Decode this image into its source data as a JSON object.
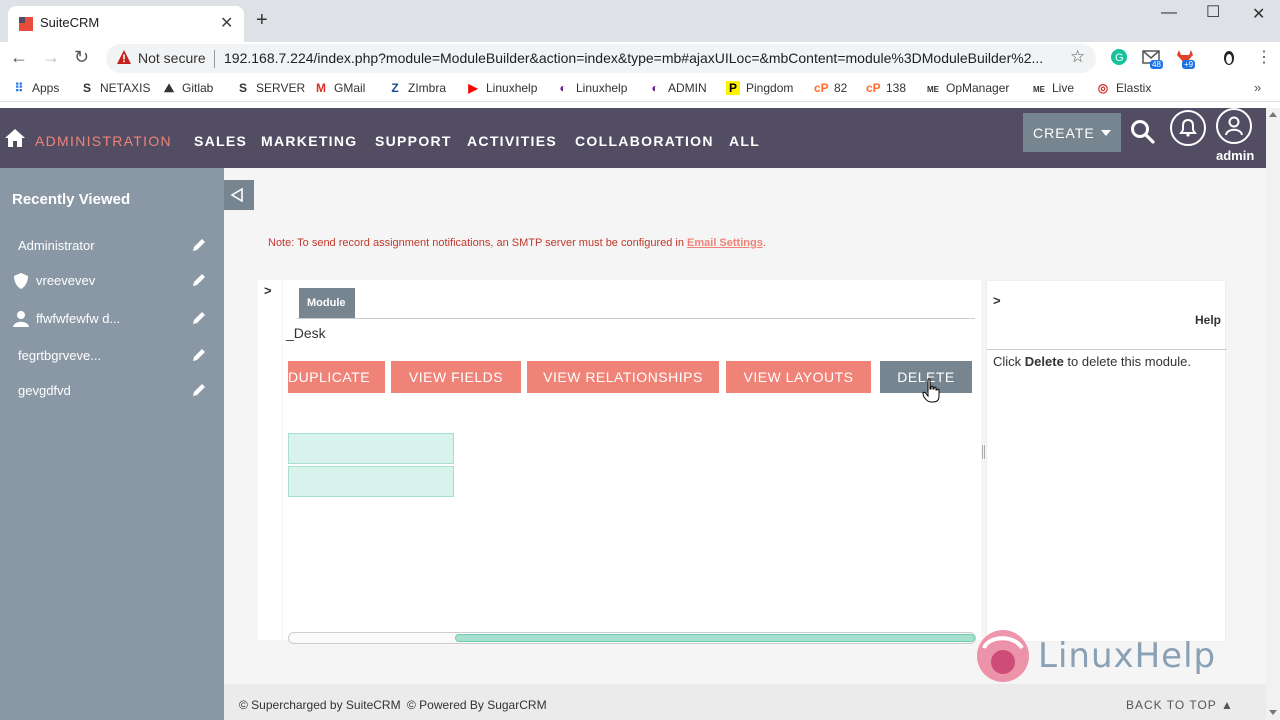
{
  "browser": {
    "tab_title": "SuiteCRM",
    "not_secure": "Not secure",
    "url": "192.168.7.224/index.php?module=ModuleBuilder&action=index&type=mb#ajaxUILoc=&mbContent=module%3DModuleBuilder%2...",
    "ext_badges": [
      "48",
      "+9"
    ],
    "bookmarks": [
      "Apps",
      "NETAXIS",
      "Gitlab",
      "SERVER",
      "GMail",
      "ZImbra",
      "Linuxhelp",
      "Linuxhelp",
      "ADMIN",
      "Pingdom",
      "82",
      "138",
      "OpManager",
      "Live",
      "Elastix"
    ]
  },
  "nav": {
    "items": [
      "ADMINISTRATION",
      "SALES",
      "MARKETING",
      "SUPPORT",
      "ACTIVITIES",
      "COLLABORATION",
      "ALL"
    ],
    "create_label": "CREATE",
    "user_label": "admin"
  },
  "sidebar": {
    "title": "Recently Viewed",
    "items": [
      {
        "label": "Administrator",
        "icon": "none"
      },
      {
        "label": "vreevevev",
        "icon": "shield-icon"
      },
      {
        "label": "ffwfwfewfw d...",
        "icon": "person-icon"
      },
      {
        "label": "fegrtbgrveve...",
        "icon": "none"
      },
      {
        "label": "gevgdfvd",
        "icon": "none"
      }
    ]
  },
  "main": {
    "note_text": "Note: To send record assignment notifications, an SMTP server must be configured in ",
    "note_link": "Email Settings",
    "note_end": ".",
    "module_tab": "Module",
    "module_name": "_Desk",
    "buttons": [
      "DUPLICATE",
      "VIEW FIELDS",
      "VIEW RELATIONSHIPS",
      "VIEW LAYOUTS",
      "DELETE"
    ],
    "left_chevron": ">",
    "help": {
      "chevron": ">",
      "title": "Help",
      "text_pre": "Click ",
      "text_bold": "Delete",
      "text_post": " to delete this module."
    }
  },
  "footer": {
    "supercharged": "© Supercharged by SuiteCRM",
    "powered": "© Powered By SugarCRM",
    "back_to_top": "BACK TO TOP"
  },
  "watermark": "LinuxHelp",
  "colors": {
    "nav_bg": "#534d64",
    "accent": "#f08377",
    "sidebar_bg": "#8a98a6",
    "button_gray": "#778591",
    "field_green": "#d8f3ec"
  }
}
